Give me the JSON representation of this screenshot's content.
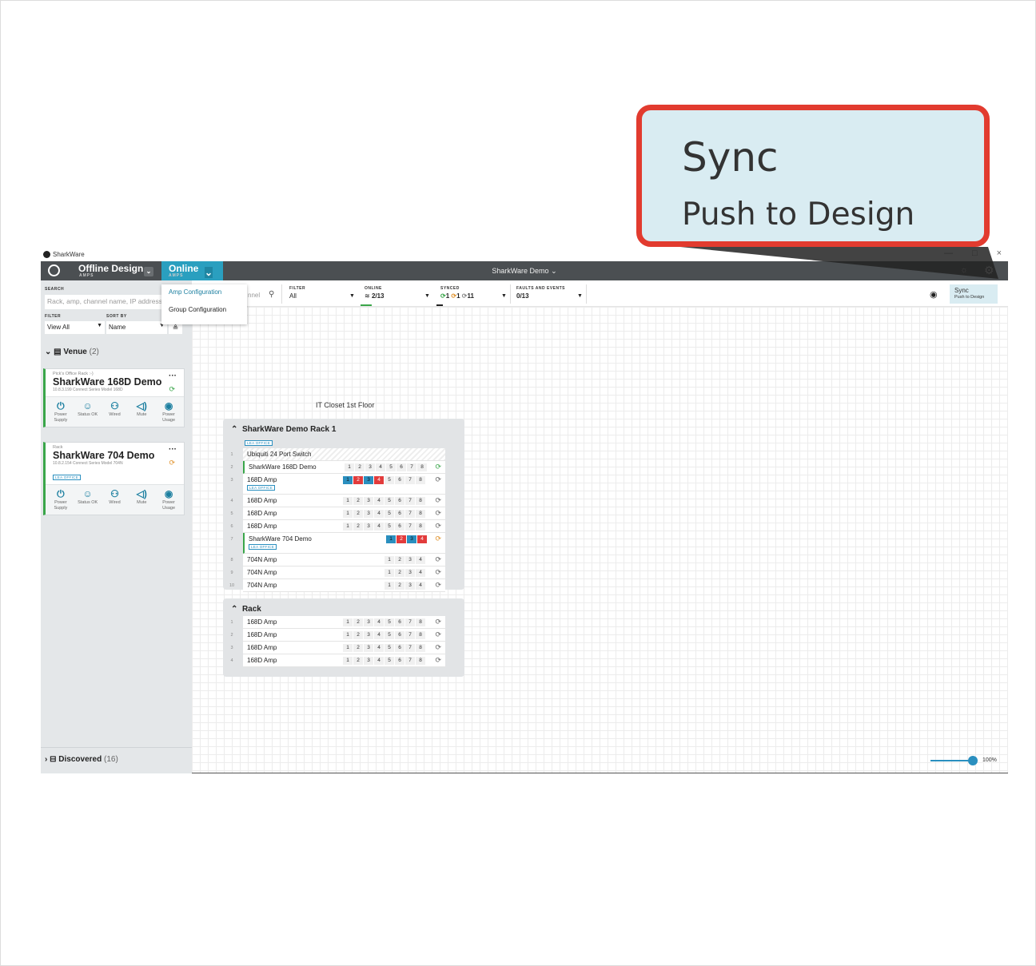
{
  "callout": {
    "title": "Sync",
    "subtitle": "Push to Design"
  },
  "window": {
    "title": "SharkWare",
    "controls": [
      "—",
      "□",
      "×"
    ]
  },
  "topbar": {
    "offline": {
      "label": "Offline Design",
      "sub": "AMPS"
    },
    "online": {
      "label": "Online",
      "sub": "AMPS"
    },
    "center": "SharkWare Demo ⌄"
  },
  "sidebar": {
    "search_label": "SEARCH",
    "search_placeholder": "Rack, amp, channel name, IP address",
    "filter_label": "FILTER",
    "sort_label": "SORT BY",
    "filter_value": "View All",
    "sort_value": "Name",
    "venue": {
      "label": "Venue",
      "count": "(2)"
    },
    "discovered": {
      "label": "Discovered",
      "count": "(16)"
    },
    "cards": [
      {
        "sub": "Pick's Office Rack :-)",
        "name": "SharkWare 168D Demo",
        "meta": "10.8.3.199  Connect Series Model 168D"
      },
      {
        "sub": "Rack",
        "name": "SharkWare 704 Demo",
        "meta": "10.8.2.154  Connect Series Model 704N",
        "tag": "LEA OFFICE"
      }
    ],
    "icon_labels": {
      "power": "Power Supply",
      "status": "Status OK",
      "wired": "Wired",
      "mute": "Mute",
      "usage": "Power Usage"
    }
  },
  "dropdown": {
    "items": [
      "Amp Configuration",
      "Group Configuration"
    ]
  },
  "filterbar": {
    "search_tail": "nnel",
    "filter": {
      "label": "FILTER",
      "value": "All"
    },
    "online": {
      "label": "ONLINE",
      "value": "2/13"
    },
    "synced": {
      "label": "SYNCED",
      "green": "1",
      "orange": "1",
      "grey": "11"
    },
    "faults": {
      "label": "FAULTS AND EVENTS",
      "value": "0/13"
    },
    "sync_button": {
      "title": "Sync",
      "sub": "Push to Design"
    }
  },
  "canvas": {
    "closet": "IT Closet 1st Floor",
    "rack1": {
      "title": "SharkWare Demo Rack 1",
      "tag": "LEA OFFICE",
      "rows": [
        {
          "idx": "1",
          "name": "Ubiquiti 24 Port Switch"
        },
        {
          "idx": "2",
          "name": "SharkWare 168D Demo"
        },
        {
          "idx": "3",
          "name": "168D Amp",
          "tag": "LEA OFFICE"
        },
        {
          "idx": "4",
          "name": "168D Amp"
        },
        {
          "idx": "5",
          "name": "168D Amp"
        },
        {
          "idx": "6",
          "name": "168D Amp"
        },
        {
          "idx": "7",
          "name": "SharkWare 704 Demo",
          "tag": "LEA OFFICE"
        },
        {
          "idx": "8",
          "name": "704N Amp"
        },
        {
          "idx": "9",
          "name": "704N Amp"
        },
        {
          "idx": "10",
          "name": "704N Amp"
        }
      ]
    },
    "rack2": {
      "title": "Rack",
      "rows": [
        {
          "idx": "1",
          "name": "168D Amp"
        },
        {
          "idx": "2",
          "name": "168D Amp"
        },
        {
          "idx": "3",
          "name": "168D Amp"
        },
        {
          "idx": "4",
          "name": "168D Amp"
        }
      ]
    },
    "channels8": [
      "1",
      "2",
      "3",
      "4",
      "5",
      "6",
      "7",
      "8"
    ],
    "channels4": [
      "1",
      "2",
      "3",
      "4"
    ],
    "zoom": "100%"
  },
  "colors": {
    "accent": "#2a9fbf",
    "danger": "#e23b2f",
    "ok": "#3aa64a"
  }
}
